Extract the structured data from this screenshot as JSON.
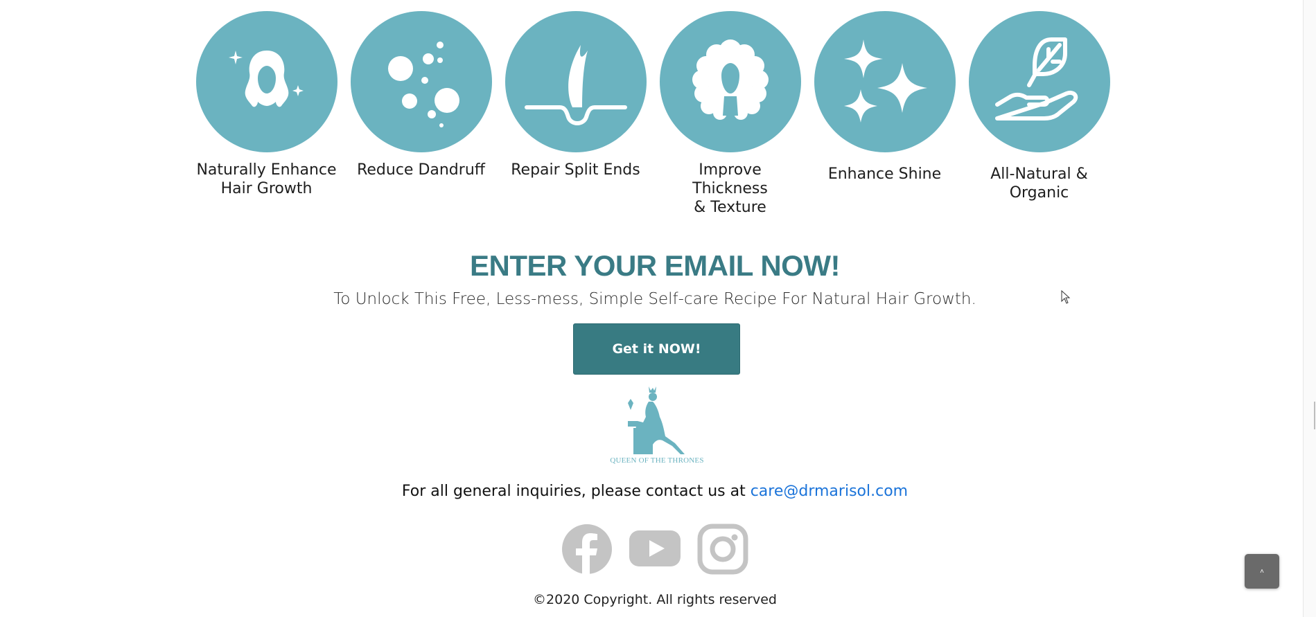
{
  "benefits": [
    {
      "label": "Naturally Enhance\nHair Growth",
      "icon": "hair-growth-icon"
    },
    {
      "label": "Reduce Dandruff",
      "icon": "dandruff-bubbles-icon"
    },
    {
      "label": "Repair Split Ends",
      "icon": "hair-follicle-icon"
    },
    {
      "label": "Improve Thickness\n& Texture",
      "icon": "curly-hair-icon"
    },
    {
      "label": "Enhance Shine",
      "icon": "sparkles-icon"
    },
    {
      "label": "All-Natural &\nOrganic",
      "icon": "leaf-in-hand-icon"
    }
  ],
  "cta": {
    "heading": "ENTER YOUR EMAIL NOW!",
    "subheading": "To Unlock This Free, Less-mess, Simple Self-care Recipe For Natural Hair Growth.",
    "button_label": "Get it NOW!"
  },
  "logo": {
    "caption": "QUEEN OF THE THRONES"
  },
  "contact": {
    "text": "For all general inquiries, please contact us at ",
    "email": "care@drmarisol.com"
  },
  "socials": [
    {
      "icon": "facebook-icon"
    },
    {
      "icon": "youtube-icon"
    },
    {
      "icon": "instagram-icon"
    }
  ],
  "footer": {
    "copyright": "©2020 Copyright. All rights reserved"
  },
  "back_to_top": {
    "glyph": "˄"
  },
  "colors": {
    "accent": "#6bb3c0",
    "heading": "#3a7b85",
    "button": "#387b82",
    "link": "#1a73d9",
    "social": "#c4c4c4"
  }
}
